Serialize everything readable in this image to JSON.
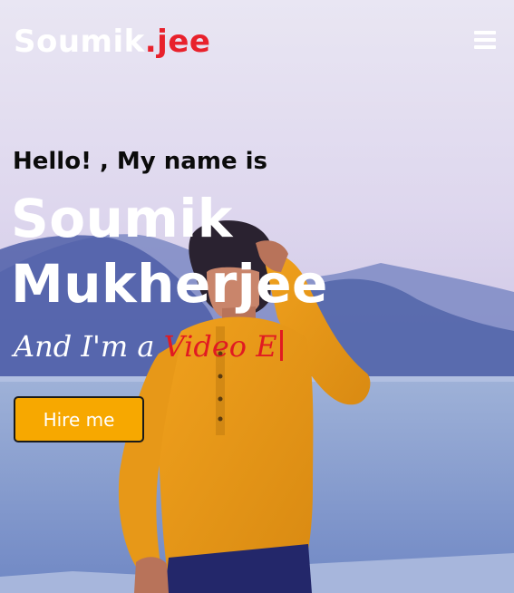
{
  "brand": {
    "name": "Soumik",
    "suffix": ".jee"
  },
  "nav": {
    "menu_icon": "hamburger-menu-icon"
  },
  "hero": {
    "greeting": "Hello! , My name is",
    "name_line1": "Soumik",
    "name_line2": "Mukherjee",
    "tagline_prefix": "And I'm a ",
    "tagline_highlight": "Video E",
    "cta_label": "Hire me"
  },
  "colors": {
    "accent": "#e8212c",
    "button": "#f7a800",
    "text_light": "#ffffff",
    "text_dark": "#0b0b0b"
  }
}
